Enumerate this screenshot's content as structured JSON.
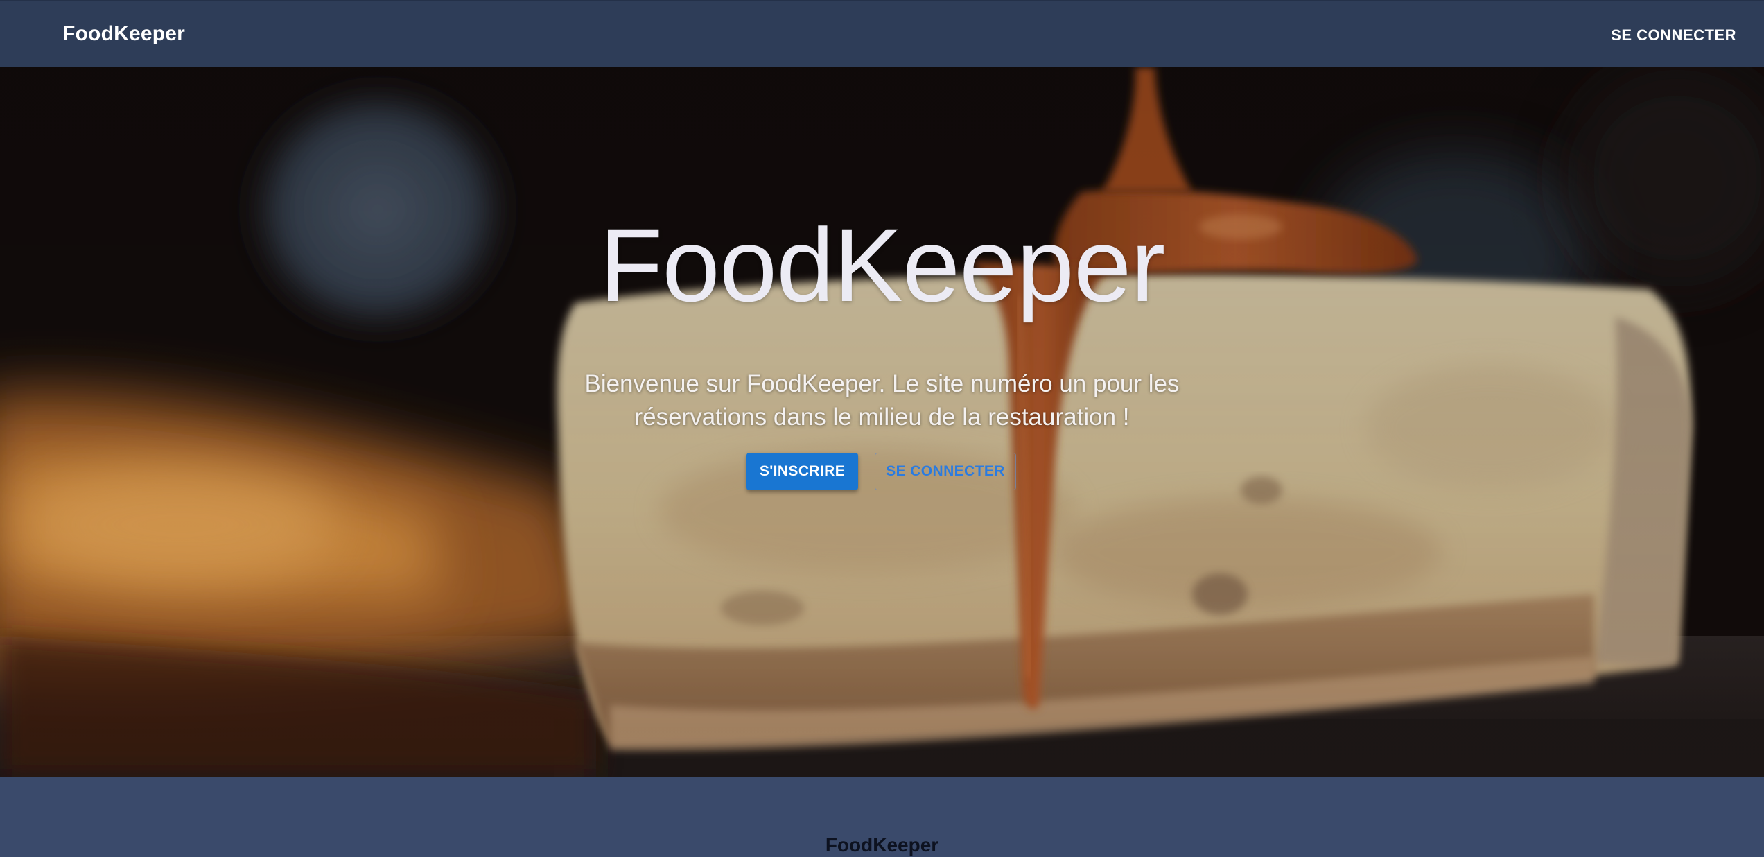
{
  "navbar": {
    "brand": "FoodKeeper",
    "login_label": "SE CONNECTER"
  },
  "hero": {
    "title": "FoodKeeper",
    "subtitle": "Bienvenue sur FoodKeeper. Le site numéro un pour les réservations dans le milieu de la restauration !",
    "signup_label": "S'INSCRIRE",
    "login_label": "SE CONNECTER",
    "background_image": "caramel-cheesecake-photo"
  },
  "footer": {
    "brand": "FoodKeeper"
  },
  "colors": {
    "navbar_bg": "#2e3d58",
    "footer_bg": "#3a4a6b",
    "primary_button": "#1976d2",
    "outline_button_text": "#2a7be0"
  }
}
